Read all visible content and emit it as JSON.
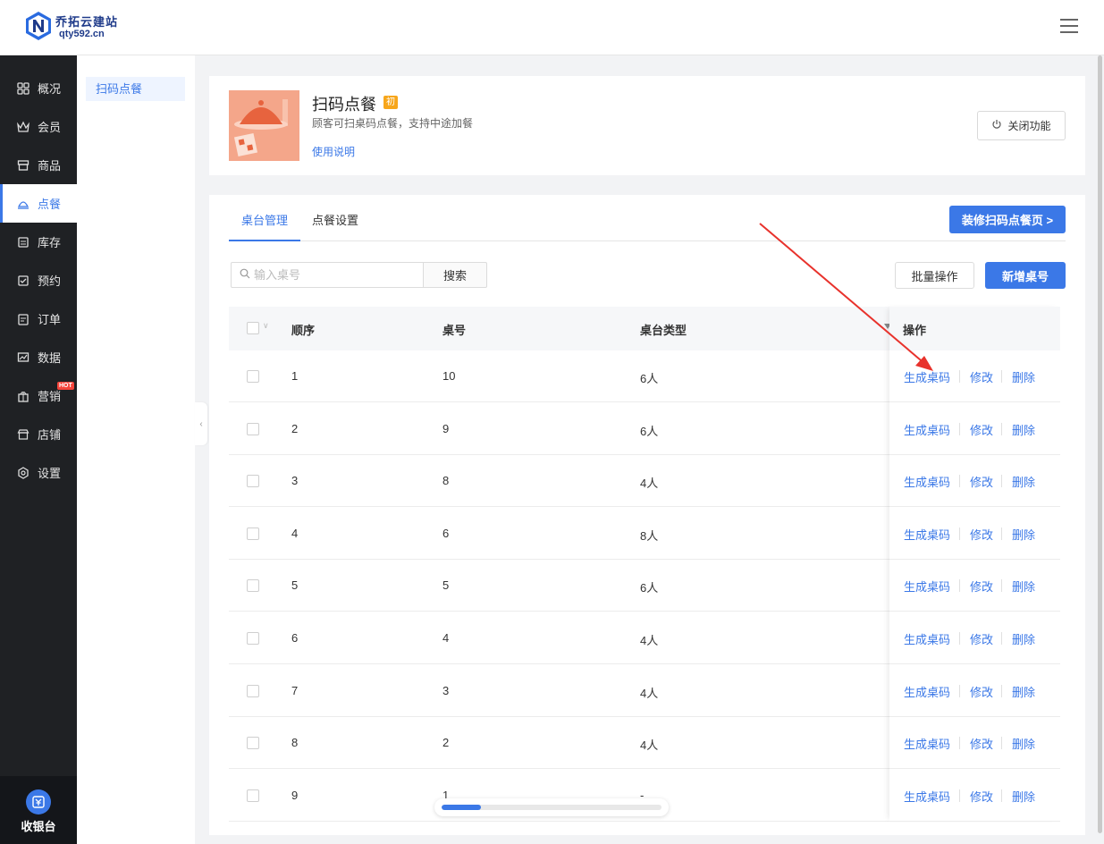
{
  "brand": {
    "name": "乔拓云建站",
    "site": "qty592.cn"
  },
  "sidebar": {
    "items": [
      {
        "label": "概况",
        "icon": "dashboard-icon"
      },
      {
        "label": "会员",
        "icon": "crown-icon"
      },
      {
        "label": "商品",
        "icon": "shop-icon"
      },
      {
        "label": "点餐",
        "icon": "dish-icon",
        "active": true
      },
      {
        "label": "库存",
        "icon": "inventory-icon"
      },
      {
        "label": "预约",
        "icon": "check-square-icon"
      },
      {
        "label": "订单",
        "icon": "clipboard-icon"
      },
      {
        "label": "数据",
        "icon": "chart-icon"
      },
      {
        "label": "营销",
        "icon": "gift-icon",
        "badge": "HOT"
      },
      {
        "label": "店铺",
        "icon": "store-icon"
      },
      {
        "label": "设置",
        "icon": "settings-icon"
      }
    ],
    "cashier": "收银台"
  },
  "subnav": {
    "active": "扫码点餐"
  },
  "feature": {
    "title": "扫码点餐",
    "badge": "初",
    "desc": "顾客可扫桌码点餐，支持中途加餐",
    "link": "使用说明",
    "close_button": "关闭功能"
  },
  "tabs": [
    {
      "label": "桌台管理",
      "active": true
    },
    {
      "label": "点餐设置"
    }
  ],
  "decorate_button": "装修扫码点餐页 >",
  "search": {
    "placeholder": "输入桌号",
    "button": "搜索"
  },
  "batch_button": "批量操作",
  "add_button": "新增桌号",
  "table": {
    "headers": {
      "order": "顺序",
      "number": "桌号",
      "type": "桌台类型",
      "ops": "操作"
    },
    "ops": {
      "gen": "生成桌码",
      "edit": "修改",
      "del": "删除"
    },
    "rows": [
      {
        "order": "1",
        "number": "10",
        "type": "6人"
      },
      {
        "order": "2",
        "number": "9",
        "type": "6人"
      },
      {
        "order": "3",
        "number": "8",
        "type": "4人"
      },
      {
        "order": "4",
        "number": "6",
        "type": "8人"
      },
      {
        "order": "5",
        "number": "5",
        "type": "6人"
      },
      {
        "order": "6",
        "number": "4",
        "type": "4人"
      },
      {
        "order": "7",
        "number": "3",
        "type": "4人"
      },
      {
        "order": "8",
        "number": "2",
        "type": "4人"
      },
      {
        "order": "9",
        "number": "1",
        "type": "-"
      }
    ]
  },
  "loading_progress": 0.18,
  "colors": {
    "accent": "#3b78e7",
    "sidebar": "#1f2124",
    "annotation_arrow": "#e8322c"
  }
}
